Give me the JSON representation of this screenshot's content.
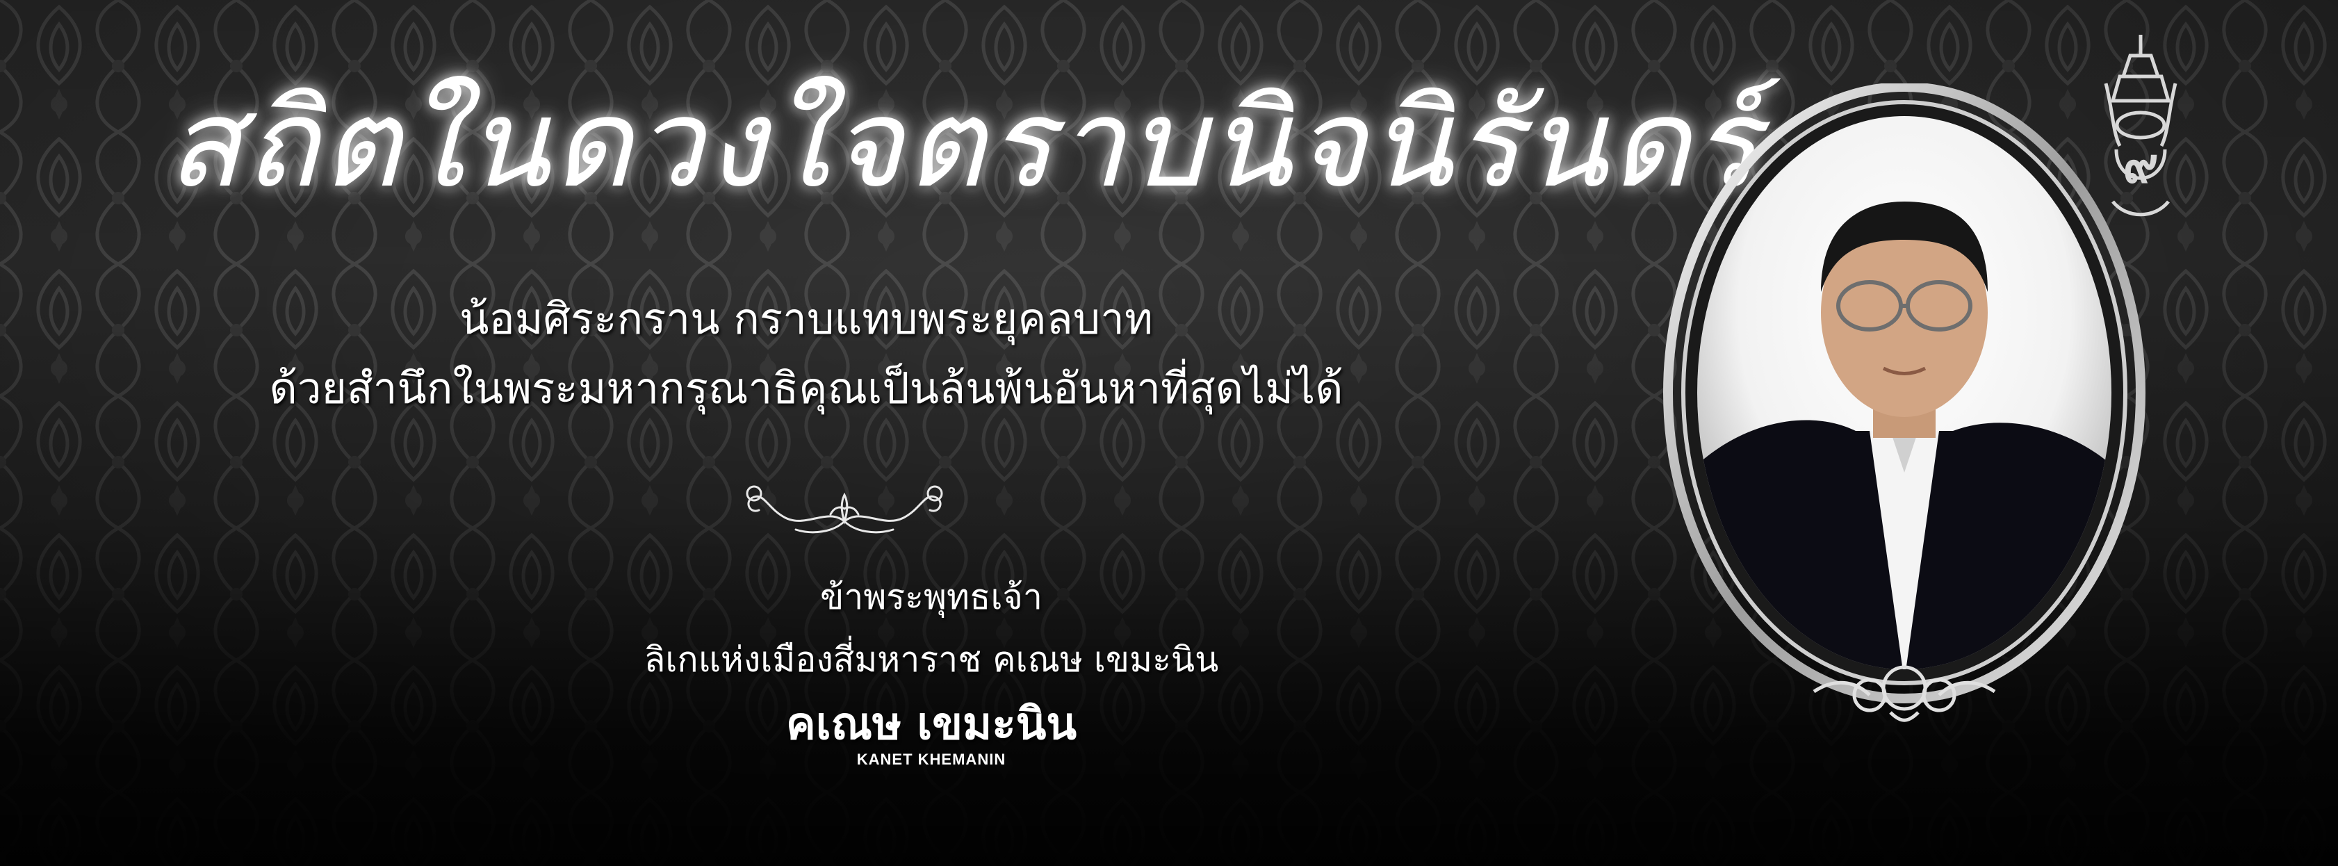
{
  "headline": "สถิตในดวงใจตราบนิจนิรันดร์",
  "verse": [
    "น้อมศิระกราน กราบแทบพระยุคลบาท",
    "ด้วยสำนึกในพระมหากรุณาธิคุณเป็นล้นพ้นอันหาที่สุดไม่ได้"
  ],
  "signoff": [
    "ข้าพระพุทธเจ้า",
    "ลิเกแห่งเมืองสี่มหาราช คเณษ เขมะนิน"
  ],
  "signature": {
    "name_thai": "คเณษ เขมะนิน",
    "name_latin": "KANET KHEMANIN"
  },
  "emblem": {
    "icon": "royal-cypher-emblem-icon",
    "numeral": "๙"
  },
  "colors": {
    "background": "#2a2a2a",
    "pattern": "#3c3c3c",
    "text": "#ffffff",
    "frame": "#d9d9d9"
  }
}
